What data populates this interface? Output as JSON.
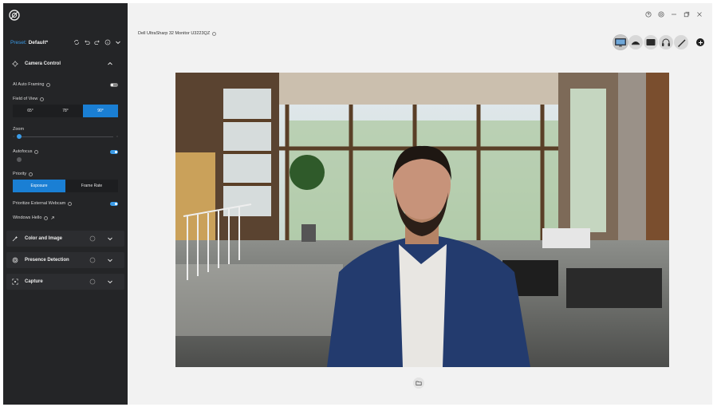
{
  "sidebar": {
    "preset": {
      "label": "Preset:",
      "value": "Default*"
    },
    "camera_control": {
      "title": "Camera Control",
      "ai_auto_framing": {
        "label": "AI Auto Framing",
        "enabled": false
      },
      "field_of_view": {
        "label": "Field of View",
        "options": [
          "65°",
          "78°",
          "90°"
        ],
        "selected": "90°"
      },
      "zoom": {
        "label": "Zoom",
        "value": 0
      },
      "autofocus": {
        "label": "Autofocus",
        "enabled": true
      },
      "priority": {
        "label": "Priority",
        "options": [
          "Exposure",
          "Frame Rate"
        ],
        "selected": "Exposure"
      },
      "prioritize_external_webcam": {
        "label": "Prioritize External Webcam",
        "enabled": true
      },
      "windows_hello": {
        "label": "Windows Hello"
      }
    },
    "sections": [
      {
        "title": "Color and Image"
      },
      {
        "title": "Presence Detection"
      },
      {
        "title": "Capture"
      }
    ]
  },
  "main": {
    "monitor_title": "Dell UltraSharp 32 Monitor U3223QZ",
    "devices": [
      "monitor",
      "webcam",
      "speaker",
      "headset",
      "pen"
    ],
    "selected_device": "monitor"
  },
  "colors": {
    "accent": "#1a7fd4",
    "sidebar_bg": "#242527",
    "main_bg": "#f2f2f2"
  },
  "icons": [
    "app-logo-icon",
    "sync-icon",
    "undo-icon",
    "redo-icon",
    "info-icon",
    "chevron-down-icon",
    "crosshair-icon",
    "color-wand-icon",
    "presence-icon",
    "capture-icon",
    "help-icon",
    "settings-icon",
    "minimize-icon",
    "restore-icon",
    "close-icon",
    "folder-icon",
    "external-link-icon"
  ]
}
